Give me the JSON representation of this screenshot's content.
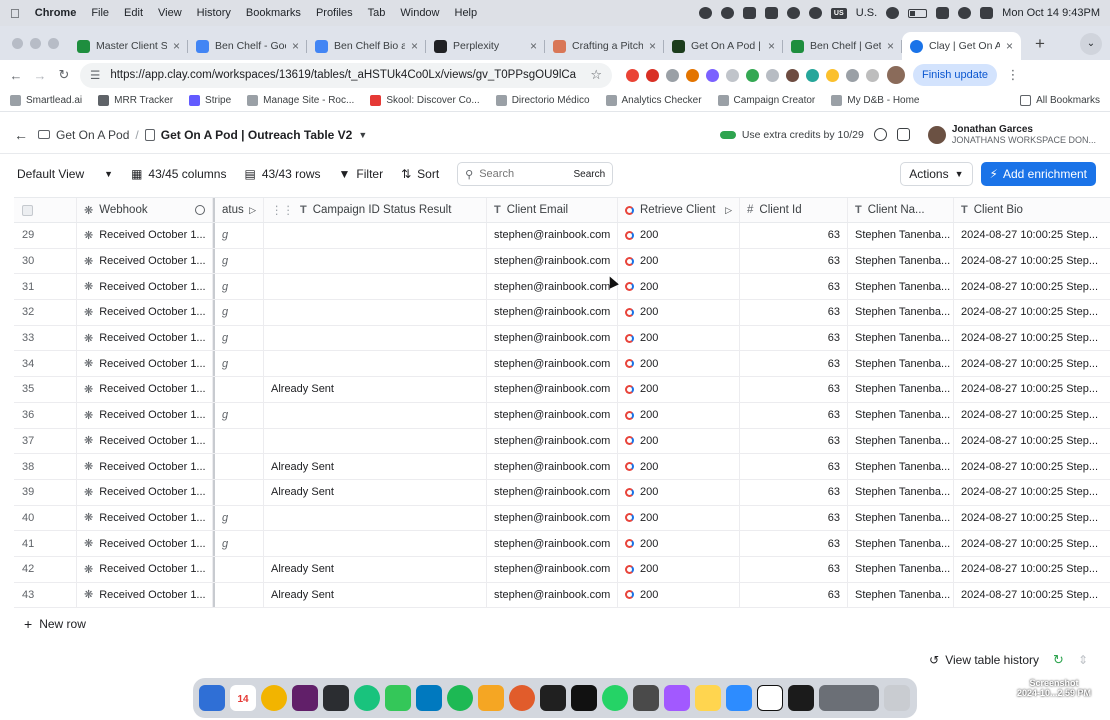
{
  "menubar": {
    "app_name": "Chrome",
    "menus": [
      "File",
      "Edit",
      "View",
      "History",
      "Bookmarks",
      "Profiles",
      "Tab",
      "Window",
      "Help"
    ],
    "input_source": "U.S.",
    "clock": "Mon Oct 14  9:43PM"
  },
  "tabs": [
    {
      "title": "Master Client S",
      "fav_color": "#1e8e3e"
    },
    {
      "title": "Ben Chelf - Goo",
      "fav_color": "#4285f4"
    },
    {
      "title": "Ben Chelf Bio a",
      "fav_color": "#4285f4"
    },
    {
      "title": "Perplexity",
      "fav_color": "#202124"
    },
    {
      "title": "Crafting a Pitch",
      "fav_color": "#d97757"
    },
    {
      "title": "Get On A Pod | p",
      "fav_color": "#1c3d1c"
    },
    {
      "title": "Ben Chelf | Get",
      "fav_color": "#1e8e3e"
    },
    {
      "title": "Clay | Get On A",
      "fav_color": "#1a73e8"
    }
  ],
  "address_bar": {
    "url": "https://app.clay.com/workspaces/13619/tables/t_aHSTUk4Co0Lx/views/gv_T0PPsgOU9lCa",
    "finish_update": "Finish update"
  },
  "bookmarks": [
    "Smartlead.ai",
    "MRR Tracker",
    "Stripe",
    "Manage Site - Roc...",
    "Skool: Discover Co...",
    "Directorio Médico",
    "Analytics Checker",
    "Campaign Creator",
    "My D&B - Home"
  ],
  "bookmarks_right": "All Bookmarks",
  "clay_header": {
    "workspace": "Get On A Pod",
    "table_name": "Get On A Pod | Outreach Table V2",
    "credits_text": "Use extra credits by 10/29",
    "user_name": "Jonathan Garces",
    "user_workspace": "JONATHANS WORKSPACE DON..."
  },
  "toolbar": {
    "view": "Default View",
    "columns": "43/45 columns",
    "rows": "43/43 rows",
    "filter": "Filter",
    "sort": "Sort",
    "search_placeholder": "Search",
    "search_button": "Search",
    "actions": "Actions",
    "add_enrichment": "Add enrichment"
  },
  "table": {
    "columns": [
      "Webhook",
      "atus",
      "Campaign ID Status Result",
      "Client Email",
      "Retrieve Client",
      "Client Id",
      "Client Na...",
      "Client Bio"
    ],
    "rows": [
      {
        "n": "29",
        "webhook": "Received October 1...",
        "status": "g",
        "result": "",
        "email": "stephen@rainbook.com",
        "retrieve": "200",
        "client_id": "63",
        "name": "Stephen Tanenba...",
        "bio": "2024-08-27 10:00:25 Step..."
      },
      {
        "n": "30",
        "webhook": "Received October 1...",
        "status": "g",
        "result": "",
        "email": "stephen@rainbook.com",
        "retrieve": "200",
        "client_id": "63",
        "name": "Stephen Tanenba...",
        "bio": "2024-08-27 10:00:25 Step..."
      },
      {
        "n": "31",
        "webhook": "Received October 1...",
        "status": "g",
        "result": "",
        "email": "stephen@rainbook.com",
        "retrieve": "200",
        "client_id": "63",
        "name": "Stephen Tanenba...",
        "bio": "2024-08-27 10:00:25 Step..."
      },
      {
        "n": "32",
        "webhook": "Received October 1...",
        "status": "g",
        "result": "",
        "email": "stephen@rainbook.com",
        "retrieve": "200",
        "client_id": "63",
        "name": "Stephen Tanenba...",
        "bio": "2024-08-27 10:00:25 Step..."
      },
      {
        "n": "33",
        "webhook": "Received October 1...",
        "status": "g",
        "result": "",
        "email": "stephen@rainbook.com",
        "retrieve": "200",
        "client_id": "63",
        "name": "Stephen Tanenba...",
        "bio": "2024-08-27 10:00:25 Step..."
      },
      {
        "n": "34",
        "webhook": "Received October 1...",
        "status": "g",
        "result": "",
        "email": "stephen@rainbook.com",
        "retrieve": "200",
        "client_id": "63",
        "name": "Stephen Tanenba...",
        "bio": "2024-08-27 10:00:25 Step..."
      },
      {
        "n": "35",
        "webhook": "Received October 1...",
        "status": "",
        "result": "Already Sent",
        "email": "stephen@rainbook.com",
        "retrieve": "200",
        "client_id": "63",
        "name": "Stephen Tanenba...",
        "bio": "2024-08-27 10:00:25 Step..."
      },
      {
        "n": "36",
        "webhook": "Received October 1...",
        "status": "g",
        "result": "",
        "email": "stephen@rainbook.com",
        "retrieve": "200",
        "client_id": "63",
        "name": "Stephen Tanenba...",
        "bio": "2024-08-27 10:00:25 Step..."
      },
      {
        "n": "37",
        "webhook": "Received October 1...",
        "status": "",
        "result": "",
        "email": "stephen@rainbook.com",
        "retrieve": "200",
        "client_id": "63",
        "name": "Stephen Tanenba...",
        "bio": "2024-08-27 10:00:25 Step..."
      },
      {
        "n": "38",
        "webhook": "Received October 1...",
        "status": "",
        "result": "Already Sent",
        "email": "stephen@rainbook.com",
        "retrieve": "200",
        "client_id": "63",
        "name": "Stephen Tanenba...",
        "bio": "2024-08-27 10:00:25 Step..."
      },
      {
        "n": "39",
        "webhook": "Received October 1...",
        "status": "",
        "result": "Already Sent",
        "email": "stephen@rainbook.com",
        "retrieve": "200",
        "client_id": "63",
        "name": "Stephen Tanenba...",
        "bio": "2024-08-27 10:00:25 Step..."
      },
      {
        "n": "40",
        "webhook": "Received October 1...",
        "status": "g",
        "result": "",
        "email": "stephen@rainbook.com",
        "retrieve": "200",
        "client_id": "63",
        "name": "Stephen Tanenba...",
        "bio": "2024-08-27 10:00:25 Step..."
      },
      {
        "n": "41",
        "webhook": "Received October 1...",
        "status": "g",
        "result": "",
        "email": "stephen@rainbook.com",
        "retrieve": "200",
        "client_id": "63",
        "name": "Stephen Tanenba...",
        "bio": "2024-08-27 10:00:25 Step..."
      },
      {
        "n": "42",
        "webhook": "Received October 1...",
        "status": "",
        "result": "Already Sent",
        "email": "stephen@rainbook.com",
        "retrieve": "200",
        "client_id": "63",
        "name": "Stephen Tanenba...",
        "bio": "2024-08-27 10:00:25 Step..."
      },
      {
        "n": "43",
        "webhook": "Received October 1...",
        "status": "",
        "result": "Already Sent",
        "email": "stephen@rainbook.com",
        "retrieve": "200",
        "client_id": "63",
        "name": "Stephen Tanenba...",
        "bio": "2024-08-27 10:00:25 Step..."
      }
    ],
    "new_row": "New row"
  },
  "bottom": {
    "view_history": "View table history"
  },
  "dock": {
    "calendar_day": "14",
    "screenshot_label": "Screenshot",
    "screenshot_date": "2024-10...2.59 PM"
  },
  "colors": {
    "accent": "#1a73e8",
    "clay_red": "#e8453c"
  }
}
